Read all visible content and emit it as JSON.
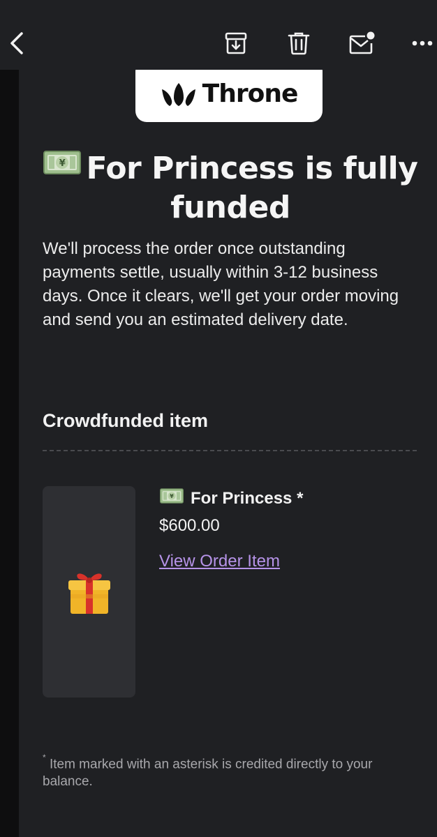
{
  "toolbar": {
    "back_icon": "chevron-left-icon",
    "archive_icon": "archive-icon",
    "trash_icon": "trash-icon",
    "mail_icon": "mark-unread-icon",
    "more_icon": "more-horizontal-icon"
  },
  "email": {
    "logo_text": "Throne",
    "headline_emoji": "money-banknote-icon",
    "headline": "For Princess is fully funded",
    "intro": "We'll process the order once outstanding payments settle, usually within 3-12 business days. Once it clears, we'll get your order moving and send you an estimated delivery date.",
    "section_title": "Crowdfunded item",
    "item": {
      "thumb_icon": "gift-box-icon",
      "name": "For Princess *",
      "price": "$600.00",
      "link": "View Order Item"
    },
    "footnote_mark": "*",
    "footnote": " Item marked with an asterisk is credited directly to your balance."
  },
  "colors": {
    "background": "#1f2023",
    "left_strip": "#0e0e0f",
    "card": "#2e2f33",
    "link": "#b693e8",
    "muted": "#a8a8ac"
  }
}
